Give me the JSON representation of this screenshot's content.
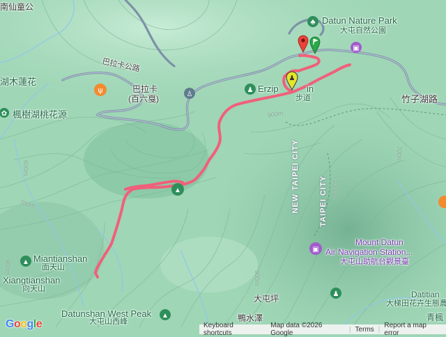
{
  "map": {
    "attribution": {
      "logo": "Google",
      "keyboard": "Keyboard shortcuts",
      "data": "Map data ©2026 Google",
      "terms": "Terms",
      "report": "Report a map error"
    },
    "labels": {
      "top_left": "南仙童公",
      "lotus_lake": "湖木蓮花",
      "maple_lake": "楓樹湖桃花源",
      "balaka_road": "巴拉卡公路",
      "balaka": "巴拉卡",
      "baiyibu": "(百六戛)",
      "erziping_en": "Erzip",
      "erziping_en2": "in",
      "erziping_zh": "步道",
      "datun_nature_en": "Datun Nature Park",
      "datun_nature_zh": "大屯自然公園",
      "zhuzihu_road": "竹子湖路",
      "new_taipei_1": "NEW TAIPEI CITY",
      "taipei_city": "TAIPEI CITY",
      "mt_datun_en1": "Mount Datun",
      "mt_datun_en2": "Air Navigation Station...",
      "mt_datun_zh": "大屯山助航台觀景臺",
      "miantianshan_en": "Miantianshan",
      "miantianshan_zh": "面天山",
      "xiangtianshan_en": "Xiangtianshan",
      "xiangtianshan_zh": "向天山",
      "datunshan_west_en": "Datunshan West Peak",
      "datunshan_west_zh": "大屯山西峰",
      "datunping": "大屯坪",
      "yazize": "鴨水澤",
      "datitian_en": "Datitian",
      "datitian_zh": "大梯田花卉生態農",
      "qingfeng": "青楓"
    },
    "contours": [
      "900m",
      "600m",
      "700m",
      "900m",
      "1000m",
      "900m",
      "700m",
      "900m"
    ],
    "colors": {
      "route": "#f0607a",
      "terrain": "#9fd6b6",
      "road": "#6f8aa3",
      "start_pin": "#e8433a",
      "end_pin": "#2aa84a",
      "hiker_pin": "#e5e52a"
    },
    "icons": [
      "tree-icon",
      "museum-icon",
      "restaurant-icon",
      "hiking-icon",
      "peak-icon",
      "pin-icon",
      "flag-icon"
    ]
  }
}
